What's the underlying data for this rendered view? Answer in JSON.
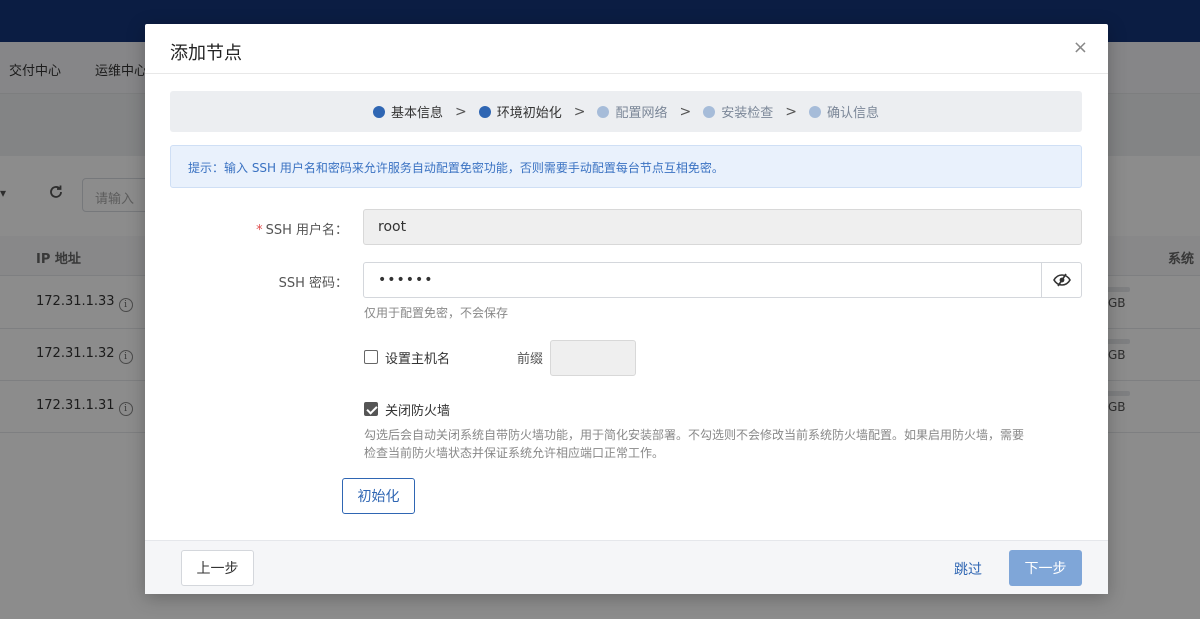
{
  "background": {
    "nav_items": [
      "交付中心",
      "运维中心"
    ],
    "search_placeholder": "请输入",
    "filter_caret": "▾",
    "table": {
      "headers": {
        "ip": "IP 地址",
        "system": "系统"
      },
      "rows": [
        {
          "ip": "172.31.1.33",
          "capacity": "GB"
        },
        {
          "ip": "172.31.1.32",
          "capacity": "GB"
        },
        {
          "ip": "172.31.1.31",
          "capacity": "GB"
        }
      ]
    }
  },
  "modal": {
    "title": "添加节点",
    "close_symbol": "×",
    "steps": [
      {
        "label": "基本信息",
        "state": "active"
      },
      {
        "label": "环境初始化",
        "state": "active"
      },
      {
        "label": "配置网络",
        "state": "pending"
      },
      {
        "label": "安装检查",
        "state": "pending"
      },
      {
        "label": "确认信息",
        "state": "pending"
      }
    ],
    "tip": "提示：输入 SSH 用户名和密码来允许服务自动配置免密功能，否则需要手动配置每台节点互相免密。",
    "form": {
      "ssh_user_label": "SSH 用户名：",
      "ssh_user_required": "*",
      "ssh_user_value": "root",
      "ssh_password_label": "SSH 密码：",
      "ssh_password_value": "••••••",
      "ssh_password_help": "仅用于配置免密，不会保存",
      "set_hostname_label": "设置主机名",
      "set_hostname_checked": false,
      "prefix_label": "前缀",
      "prefix_value": "",
      "disable_firewall_label": "关闭防火墙",
      "disable_firewall_checked": true,
      "disable_firewall_help_line1": "勾选后会自动关闭系统自带防火墙功能，用于简化安装部署。不勾选则不会修改当前系统防火墙配置。如果启用防火墙，需要",
      "disable_firewall_help_line2": "检查当前防火墙状态并保证系统允许相应端口正常工作。",
      "init_button": "初始化"
    },
    "footer": {
      "prev_button": "上一步",
      "skip_link": "跳过",
      "next_button": "下一步"
    }
  },
  "colors": {
    "brand": "#15367a",
    "accent": "#2f66b3",
    "primary_disabled": "#7fa6d8",
    "step_pending": "#a6bcd9",
    "tip_bg": "#e9f1fc",
    "required": "#e04b4b"
  }
}
